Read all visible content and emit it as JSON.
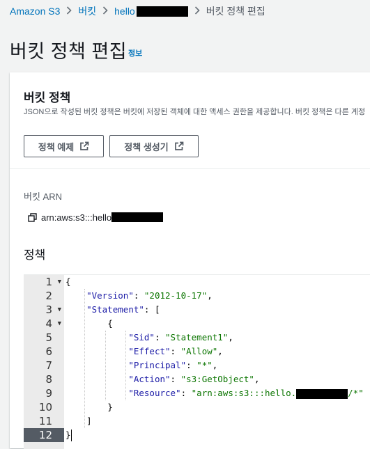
{
  "breadcrumb": {
    "items": [
      "Amazon S3",
      "버킷",
      "hello"
    ],
    "current": "버킷 정책 편집"
  },
  "page": {
    "title": "버킷 정책 편집",
    "info_link": "정보"
  },
  "section": {
    "title": "버킷 정책",
    "description": "JSON으로 작성된 버킷 정책은 버킷에 저장된 객체에 대한 액세스 권한을 제공합니다. 버킷 정책은 다른 계정",
    "buttons": {
      "examples": "정책 예제",
      "generator": "정책 생성기"
    }
  },
  "arn": {
    "label": "버킷 ARN",
    "value_prefix": "arn:aws:s3:::hello"
  },
  "policy_label": "정책",
  "editor": {
    "line_numbers": [
      "1",
      "2",
      "3",
      "4",
      "5",
      "6",
      "7",
      "8",
      "9",
      "10",
      "11",
      "12"
    ],
    "folds": [
      "▼",
      "",
      "▼",
      "▼",
      "",
      "",
      "",
      "",
      "",
      "",
      "",
      ""
    ],
    "active_line": "12",
    "code": {
      "open_brace": "{",
      "version_key": "\"Version\"",
      "version_val": "\"2012-10-17\"",
      "statement_key": "\"Statement\"",
      "open_bracket": "[",
      "open_obj": "{",
      "sid_key": "\"Sid\"",
      "sid_val": "\"Statement1\"",
      "effect_key": "\"Effect\"",
      "effect_val": "\"Allow\"",
      "principal_key": "\"Principal\"",
      "principal_val": "\"*\"",
      "action_key": "\"Action\"",
      "action_val": "\"s3:GetObject\"",
      "resource_key": "\"Resource\"",
      "resource_val_prefix": "\"arn:aws:s3:::hello.",
      "resource_val_suffix": "/*\"",
      "close_obj": "}",
      "close_bracket": "]",
      "close_brace": "}"
    }
  },
  "colors": {
    "link": "#0073bb",
    "text": "#16191f",
    "muted": "#545b64",
    "gutter_active": "#545b64"
  },
  "icons": {
    "separator": "chevron-right-icon",
    "external": "external-link-icon",
    "copy": "copy-icon",
    "fold": "fold-arrow-icon"
  }
}
